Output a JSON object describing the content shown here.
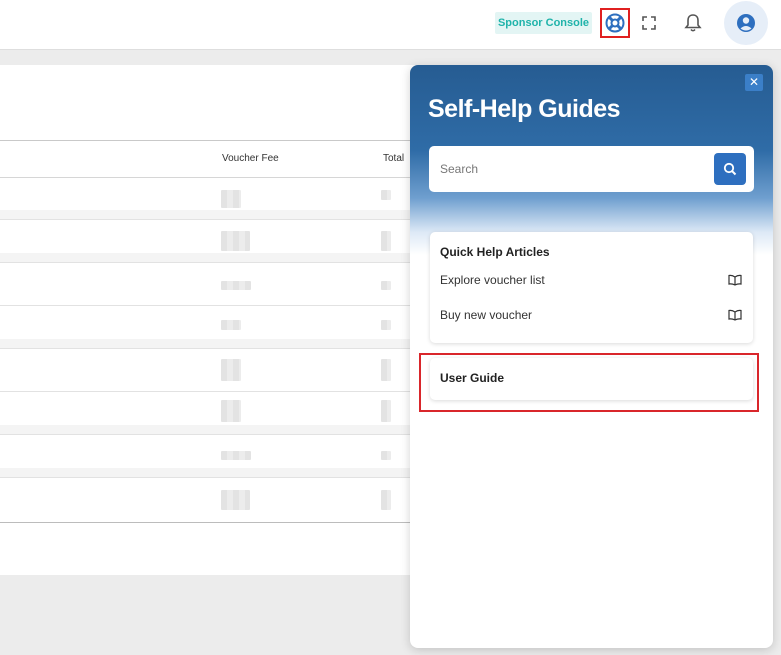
{
  "topbar": {
    "sponsor_console_label": "Sponsor Console",
    "help_icon": "lifebuoy-icon",
    "fullscreen_icon": "fullscreen-icon",
    "notifications_icon": "bell-icon",
    "avatar_icon": "user-circle-icon"
  },
  "table": {
    "columns": [
      "Voucher Fee",
      "Total"
    ],
    "row_count": 8
  },
  "help_panel": {
    "title": "Self-Help Guides",
    "close_label": "✕",
    "search": {
      "placeholder": "Search",
      "value": ""
    },
    "quick_help": {
      "title": "Quick Help Articles",
      "articles": [
        {
          "label": "Explore voucher list",
          "icon": "book-open-icon"
        },
        {
          "label": "Buy new voucher",
          "icon": "book-open-icon"
        }
      ]
    },
    "user_guide": {
      "title": "User Guide"
    }
  },
  "colors": {
    "accent_blue": "#2e6fbf",
    "sponsor_teal": "#1fb3aa",
    "highlight_red": "#e02020",
    "hero_top": "#265c92"
  }
}
